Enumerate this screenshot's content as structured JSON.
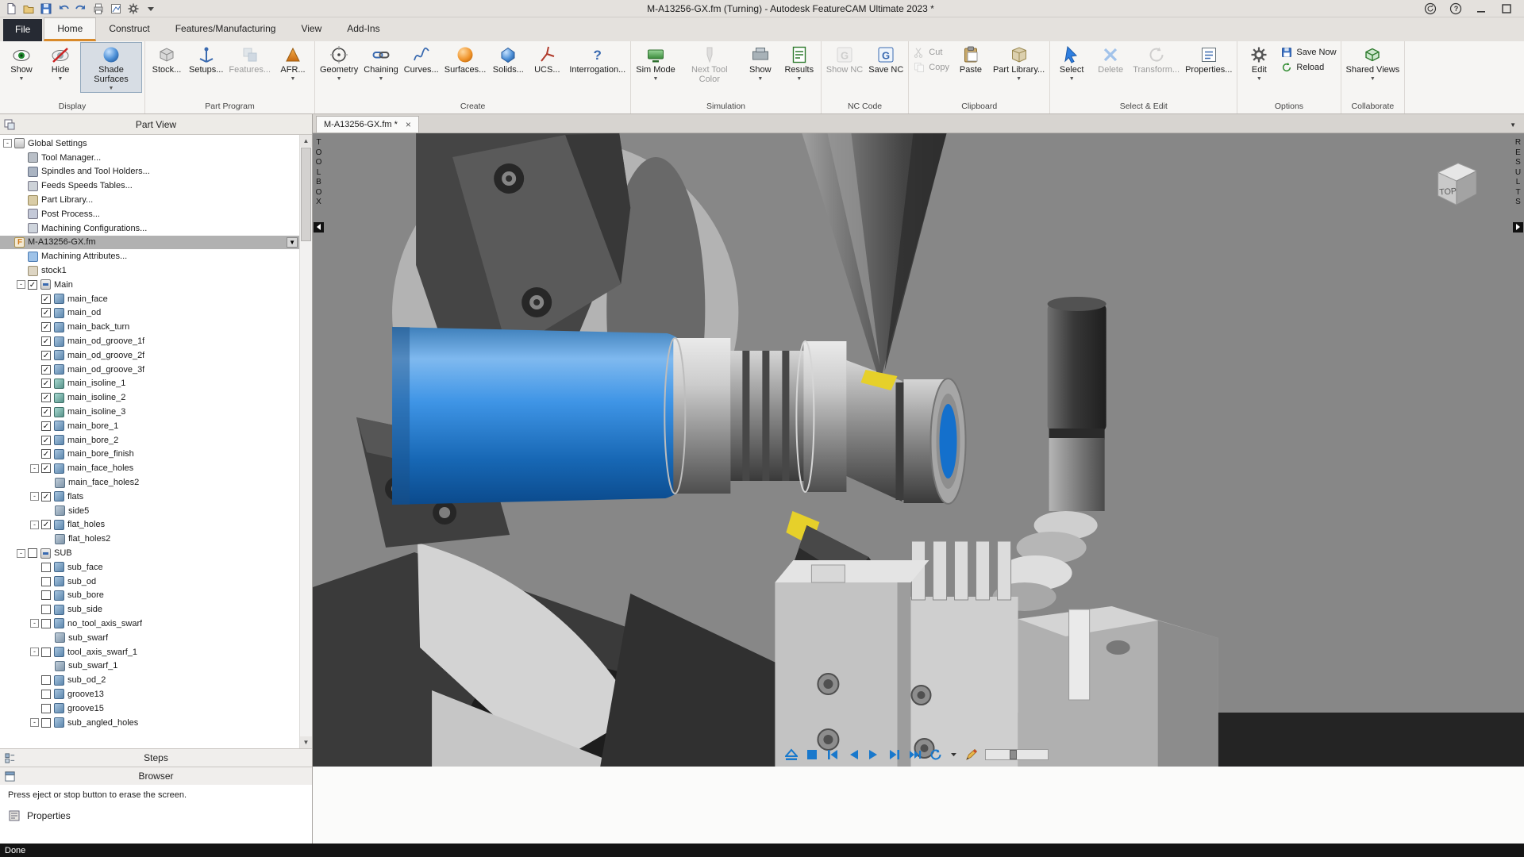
{
  "colors": {
    "accent_blue": "#1878cc",
    "workpiece_blue": "#1b76d2",
    "insert_yellow": "#e6d02a",
    "titlebar_bg": "#e4e1dd",
    "ribbon_bg": "#f6f5f3",
    "viewport_bg": "#878787",
    "statusbar_bg": "#141414",
    "active_tab_underline": "#d98a2a"
  },
  "icons": {
    "close_tab": "×",
    "caret_down": "▼",
    "scroll_up": "▲",
    "scroll_down": "▼",
    "check": "✓",
    "expander_collapse": "−",
    "tree_dropdown": "▼"
  },
  "titlebar": {
    "title": "M-A13256-GX.fm (Turning) - Autodesk FeatureCAM Ultimate 2023 *",
    "quick_access_icons": [
      "new-document",
      "open-folder",
      "save",
      "undo",
      "redo",
      "print",
      "plot",
      "settings-gear",
      "caret-down"
    ],
    "window_icons": [
      "sync",
      "help",
      "minimize",
      "maximize"
    ]
  },
  "ribbon": {
    "tabs": [
      {
        "label": "File",
        "file": true
      },
      {
        "label": "Home",
        "active": true
      },
      {
        "label": "Construct"
      },
      {
        "label": "Features/Manufacturing"
      },
      {
        "label": "View"
      },
      {
        "label": "Add-Ins"
      }
    ],
    "groups": [
      {
        "label": "Display",
        "buttons": [
          {
            "label": "Show",
            "icon": "eye-show",
            "caret": true
          },
          {
            "label": "Hide",
            "icon": "eye-hide",
            "caret": true
          },
          {
            "label": "Shade Surfaces",
            "icon": "shade-surfaces",
            "caret": true,
            "active": true
          }
        ]
      },
      {
        "label": "Part Program",
        "buttons": [
          {
            "label": "Stock...",
            "icon": "stock"
          },
          {
            "label": "Setups...",
            "icon": "setups"
          },
          {
            "label": "Features...",
            "icon": "features",
            "disabled": true
          },
          {
            "label": "AFR...",
            "icon": "afr",
            "caret": true
          }
        ]
      },
      {
        "label": "Create",
        "buttons": [
          {
            "label": "Geometry",
            "icon": "geometry",
            "caret": true
          },
          {
            "label": "Chaining",
            "icon": "chaining",
            "caret": true
          },
          {
            "label": "Curves...",
            "icon": "curves"
          },
          {
            "label": "Surfaces...",
            "icon": "surfaces"
          },
          {
            "label": "Solids...",
            "icon": "solids"
          },
          {
            "label": "UCS...",
            "icon": "ucs"
          },
          {
            "label": "Interrogation...",
            "icon": "interrogation"
          }
        ]
      },
      {
        "label": "Simulation",
        "buttons": [
          {
            "label": "Sim Mode",
            "icon": "sim-mode",
            "caret": true
          },
          {
            "label": "Next Tool Color",
            "icon": "next-tool-color",
            "disabled": true
          },
          {
            "label": "Show",
            "icon": "sim-show",
            "caret": true
          },
          {
            "label": "Results",
            "icon": "results",
            "caret": true
          }
        ]
      },
      {
        "label": "NC Code",
        "buttons": [
          {
            "label": "Show NC",
            "icon": "show-nc",
            "disabled": true
          },
          {
            "label": "Save NC",
            "icon": "save-nc"
          }
        ]
      },
      {
        "label": "Clipboard",
        "buttons": [
          {
            "label": "Cut",
            "icon": "cut",
            "disabled": true,
            "small": true
          },
          {
            "label": "Copy",
            "icon": "copy",
            "disabled": true,
            "small": true
          },
          {
            "label": "Paste",
            "icon": "paste"
          },
          {
            "label": "Part Library...",
            "icon": "part-library",
            "caret": true
          }
        ]
      },
      {
        "label": "Select & Edit",
        "buttons": [
          {
            "label": "Select",
            "icon": "select",
            "caret": true
          },
          {
            "label": "Delete",
            "icon": "delete",
            "disabled": true
          },
          {
            "label": "Transform...",
            "icon": "transform",
            "disabled": true
          },
          {
            "label": "Properties...",
            "icon": "properties"
          }
        ]
      },
      {
        "label": "Options",
        "buttons": [
          {
            "label": "Edit",
            "icon": "edit-gear",
            "caret": true
          },
          {
            "label": "Save Now",
            "icon": "save-now",
            "small": true
          },
          {
            "label": "Reload",
            "icon": "reload",
            "small": true
          }
        ]
      },
      {
        "label": "Collaborate",
        "buttons": [
          {
            "label": "Shared Views",
            "icon": "shared-views",
            "caret": true
          }
        ]
      }
    ]
  },
  "part_view": {
    "title": "Part View",
    "tree": [
      {
        "label": "Global Settings",
        "level": 0,
        "icon": "settings",
        "expander": "minus"
      },
      {
        "label": "Tool Manager...",
        "level": 1,
        "icon": "tool-manager"
      },
      {
        "label": "Spindles and Tool Holders...",
        "level": 1,
        "icon": "spindles"
      },
      {
        "label": "Feeds  Speeds Tables...",
        "level": 1,
        "icon": "feeds"
      },
      {
        "label": "Part Library...",
        "level": 1,
        "icon": "library"
      },
      {
        "label": "Post Process...",
        "level": 1,
        "icon": "post"
      },
      {
        "label": "Machining Configurations...",
        "level": 1,
        "icon": "config"
      },
      {
        "label": "M-A13256-GX.fm",
        "level": 0,
        "icon": "part",
        "selected": true,
        "dropdown": true
      },
      {
        "label": "Machining Attributes...",
        "level": 1,
        "icon": "attributes"
      },
      {
        "label": "stock1",
        "level": 1,
        "icon": "stock"
      },
      {
        "label": "Main",
        "level": 1,
        "icon": "setup",
        "checkbox": "checked",
        "expander": "minus"
      },
      {
        "label": "main_face",
        "level": 2,
        "icon": "feature",
        "checkbox": "checked"
      },
      {
        "label": "main_od",
        "level": 2,
        "icon": "feature",
        "checkbox": "checked"
      },
      {
        "label": "main_back_turn",
        "level": 2,
        "icon": "feature",
        "checkbox": "checked"
      },
      {
        "label": "main_od_groove_1f",
        "level": 2,
        "icon": "feature",
        "checkbox": "checked"
      },
      {
        "label": "main_od_groove_2f",
        "level": 2,
        "icon": "feature",
        "checkbox": "checked"
      },
      {
        "label": "main_od_groove_3f",
        "level": 2,
        "icon": "feature",
        "checkbox": "checked"
      },
      {
        "label": "main_isoline_1",
        "level": 2,
        "icon": "isoline",
        "checkbox": "checked"
      },
      {
        "label": "main_isoline_2",
        "level": 2,
        "icon": "isoline",
        "checkbox": "checked"
      },
      {
        "label": "main_isoline_3",
        "level": 2,
        "icon": "isoline",
        "checkbox": "checked"
      },
      {
        "label": "main_bore_1",
        "level": 2,
        "icon": "feature",
        "checkbox": "checked"
      },
      {
        "label": "main_bore_2",
        "level": 2,
        "icon": "feature",
        "checkbox": "checked"
      },
      {
        "label": "main_bore_finish",
        "level": 2,
        "icon": "feature",
        "checkbox": "checked"
      },
      {
        "label": "main_face_holes",
        "level": 2,
        "icon": "feature",
        "checkbox": "checked",
        "expander": "minus"
      },
      {
        "label": "main_face_holes2",
        "level": 3,
        "icon": "pattern"
      },
      {
        "label": "flats",
        "level": 2,
        "icon": "feature",
        "checkbox": "checked",
        "expander": "minus"
      },
      {
        "label": "side5",
        "level": 3,
        "icon": "pattern"
      },
      {
        "label": "flat_holes",
        "level": 2,
        "icon": "feature",
        "checkbox": "checked",
        "expander": "minus"
      },
      {
        "label": "flat_holes2",
        "level": 3,
        "icon": "pattern"
      },
      {
        "label": "SUB",
        "level": 1,
        "icon": "setup",
        "checkbox": "unchecked",
        "expander": "minus"
      },
      {
        "label": "sub_face",
        "level": 2,
        "icon": "feature",
        "checkbox": "unchecked"
      },
      {
        "label": "sub_od",
        "level": 2,
        "icon": "feature",
        "checkbox": "unchecked"
      },
      {
        "label": "sub_bore",
        "level": 2,
        "icon": "feature",
        "checkbox": "unchecked"
      },
      {
        "label": "sub_side",
        "level": 2,
        "icon": "feature",
        "checkbox": "unchecked"
      },
      {
        "label": "no_tool_axis_swarf",
        "level": 2,
        "icon": "feature",
        "checkbox": "unchecked",
        "expander": "minus"
      },
      {
        "label": "sub_swarf",
        "level": 3,
        "icon": "pattern"
      },
      {
        "label": "tool_axis_swarf_1",
        "level": 2,
        "icon": "feature",
        "checkbox": "unchecked",
        "expander": "minus"
      },
      {
        "label": "sub_swarf_1",
        "level": 3,
        "icon": "pattern"
      },
      {
        "label": "sub_od_2",
        "level": 2,
        "icon": "feature",
        "checkbox": "unchecked"
      },
      {
        "label": "groove13",
        "level": 2,
        "icon": "feature",
        "checkbox": "unchecked"
      },
      {
        "label": "groove15",
        "level": 2,
        "icon": "feature",
        "checkbox": "unchecked"
      },
      {
        "label": "sub_angled_holes",
        "level": 2,
        "icon": "feature",
        "checkbox": "unchecked",
        "expander": "minus"
      }
    ],
    "bottom_bars": {
      "steps": "Steps",
      "browser": "Browser"
    },
    "hint": "Press eject or stop button to erase the screen.",
    "properties_label": "Properties"
  },
  "document_tab": {
    "label": "M-A13256-GX.fm *"
  },
  "viewport": {
    "toolbox_tab": "TOOLBOX",
    "results_tab": "RESULTS",
    "viewcube_face": "TOP",
    "playback_controls": [
      "eject",
      "stop",
      "step-back",
      "play-reverse",
      "play",
      "step-forward",
      "fast-forward-end",
      "loop",
      "caret-down",
      "pencil",
      "speed-slider"
    ]
  },
  "statusbar": {
    "text": "Done"
  }
}
